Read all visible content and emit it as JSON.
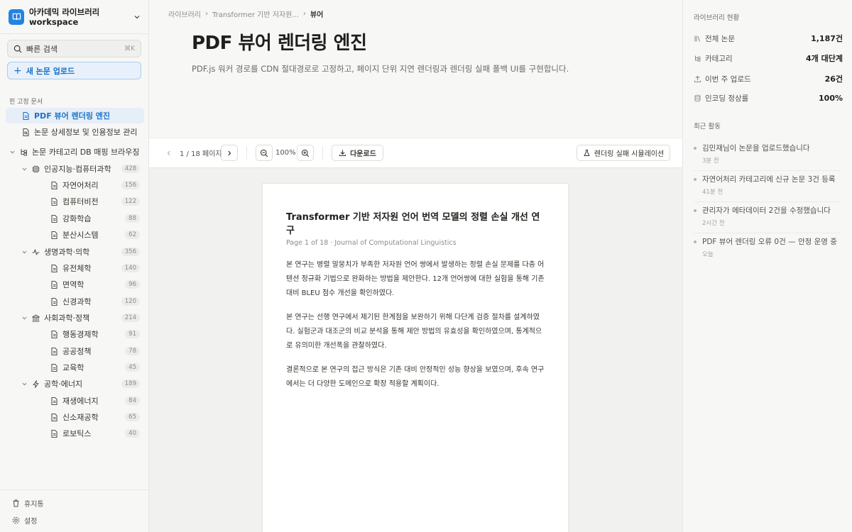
{
  "sidebar": {
    "workspace": {
      "name_line1": "아카데믹 라이브러리",
      "name_line2": "workspace"
    },
    "search": {
      "label": "빠른 검색",
      "shortcut": "⌘K"
    },
    "upload_label": "새 논문 업로드",
    "pinned_label": "핀 고정 문서",
    "pinned": [
      {
        "label": "PDF 뷰어 렌더링 엔진",
        "active": true
      },
      {
        "label": "논문 상세정보 및 인용정보 관리",
        "active": false
      }
    ],
    "tree_root": "논문 카테고리 DB 매핑 브라우징",
    "categories": [
      {
        "label": "인공지능·컴퓨터과학",
        "count": "428",
        "icon": "cpu-icon",
        "children": [
          {
            "label": "자연어처리",
            "count": "156"
          },
          {
            "label": "컴퓨터비전",
            "count": "122"
          },
          {
            "label": "강화학습",
            "count": "88"
          },
          {
            "label": "분산시스템",
            "count": "62"
          }
        ]
      },
      {
        "label": "생명과학·의학",
        "count": "356",
        "icon": "pulse-icon",
        "children": [
          {
            "label": "유전체학",
            "count": "140"
          },
          {
            "label": "면역학",
            "count": "96"
          },
          {
            "label": "신경과학",
            "count": "120"
          }
        ]
      },
      {
        "label": "사회과학·정책",
        "count": "214",
        "icon": "landmark-icon",
        "children": [
          {
            "label": "행동경제학",
            "count": "91"
          },
          {
            "label": "공공정책",
            "count": "78"
          },
          {
            "label": "교육학",
            "count": "45"
          }
        ]
      },
      {
        "label": "공학·에너지",
        "count": "189",
        "icon": "bolt-icon",
        "children": [
          {
            "label": "재생에너지",
            "count": "84"
          },
          {
            "label": "신소재공학",
            "count": "65"
          },
          {
            "label": "로보틱스",
            "count": "40"
          }
        ]
      }
    ],
    "bottom": {
      "trash": "휴지통",
      "settings": "설정"
    }
  },
  "main": {
    "breadcrumb": [
      "라이브러리",
      "Transformer 기반 저자원...",
      "뷰어"
    ],
    "title": "PDF 뷰어 렌더링 엔진",
    "description": "PDF.js 워커 경로를 CDN 절대경로로 고정하고, 페이지 단위 지연 렌더링과 렌더링 실패 폴백 UI를 구현합니다.",
    "toolbar": {
      "page_indicator": "1 / 18 페이지",
      "zoom": "100%",
      "download": "다운로드",
      "simulate": "렌더링 실패 시뮬레이션"
    },
    "document": {
      "title": "Transformer 기반 저자원 언어 번역 모델의 정렬 손실 개선 연구",
      "meta": "Page 1 of 18 · Journal of Computational Linguistics",
      "paragraphs": [
        "본 연구는 병렬 말뭉치가 부족한 저자원 언어 쌍에서 발생하는 정렬 손실 문제를 다층 어텐션 정규화 기법으로 완화하는 방법을 제안한다. 12개 언어쌍에 대한 실험을 통해 기존 대비 BLEU 점수 개선을 확인하였다.",
        "본 연구는 선행 연구에서 제기된 한계점을 보완하기 위해 다단계 검증 절차를 설계하였다. 실험군과 대조군의 비교 분석을 통해 제안 방법의 유효성을 확인하였으며, 통계적으로 유의미한 개선폭을 관찰하였다.",
        "결론적으로 본 연구의 접근 방식은 기존 대비 안정적인 성능 향상을 보였으며, 후속 연구에서는 더 다양한 도메인으로 확장 적용할 계획이다."
      ]
    }
  },
  "right": {
    "stats_label": "라이브러리 현황",
    "stats": [
      {
        "label": "전체 논문",
        "value": "1,187건",
        "icon": "library-icon"
      },
      {
        "label": "카테고리",
        "value": "4개 대단계",
        "icon": "hierarchy-icon"
      },
      {
        "label": "이번 주 업로드",
        "value": "26건",
        "icon": "upload-icon"
      },
      {
        "label": "인코딩 정상률",
        "value": "100%",
        "icon": "database-icon"
      }
    ],
    "activity_label": "최근 활동",
    "activity": [
      {
        "text": "김민재님이 논문을 업로드했습니다",
        "time": "3분 전"
      },
      {
        "text": "자연어처리 카테고리에 신규 논문 3건 등록",
        "time": "41분 전"
      },
      {
        "text": "관리자가 메타데이터 2건을 수정했습니다",
        "time": "2시간 전"
      },
      {
        "text": "PDF 뷰어 렌더링 오류 0건 — 안정 운영 중",
        "time": "오늘"
      }
    ]
  }
}
